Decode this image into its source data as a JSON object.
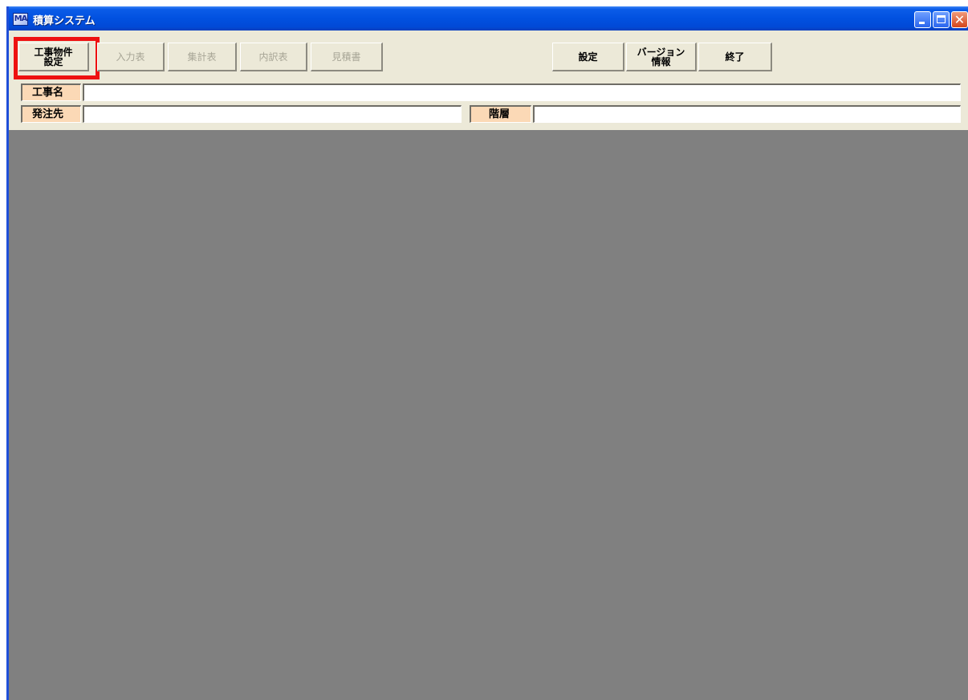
{
  "window": {
    "title": "積算システム",
    "app_icon_text": "MA",
    "controls": {
      "minimize": "minimize",
      "maximize": "maximize",
      "close": "✕"
    }
  },
  "toolbar": {
    "project_setup": {
      "line1": "工事物件",
      "line2": "設定"
    },
    "input_sheet": "入力表",
    "summary_sheet": "集計表",
    "breakdown_sheet": "内訳表",
    "estimate": "見積書",
    "settings": "設定",
    "version_info": {
      "line1": "バージョン",
      "line2": "情報"
    },
    "exit": "終了",
    "disabled_color": "#a7a596",
    "highlight_color": "#ee1111"
  },
  "fields": {
    "project_name": {
      "label": "工事名",
      "value": ""
    },
    "client": {
      "label": "発注先",
      "value": ""
    },
    "floor": {
      "label": "階層",
      "value": ""
    }
  },
  "colors": {
    "title_bar": "#0151e0",
    "client_bg": "#ece9d8",
    "label_bg": "#fbd9b6",
    "workspace_bg": "#808080"
  }
}
